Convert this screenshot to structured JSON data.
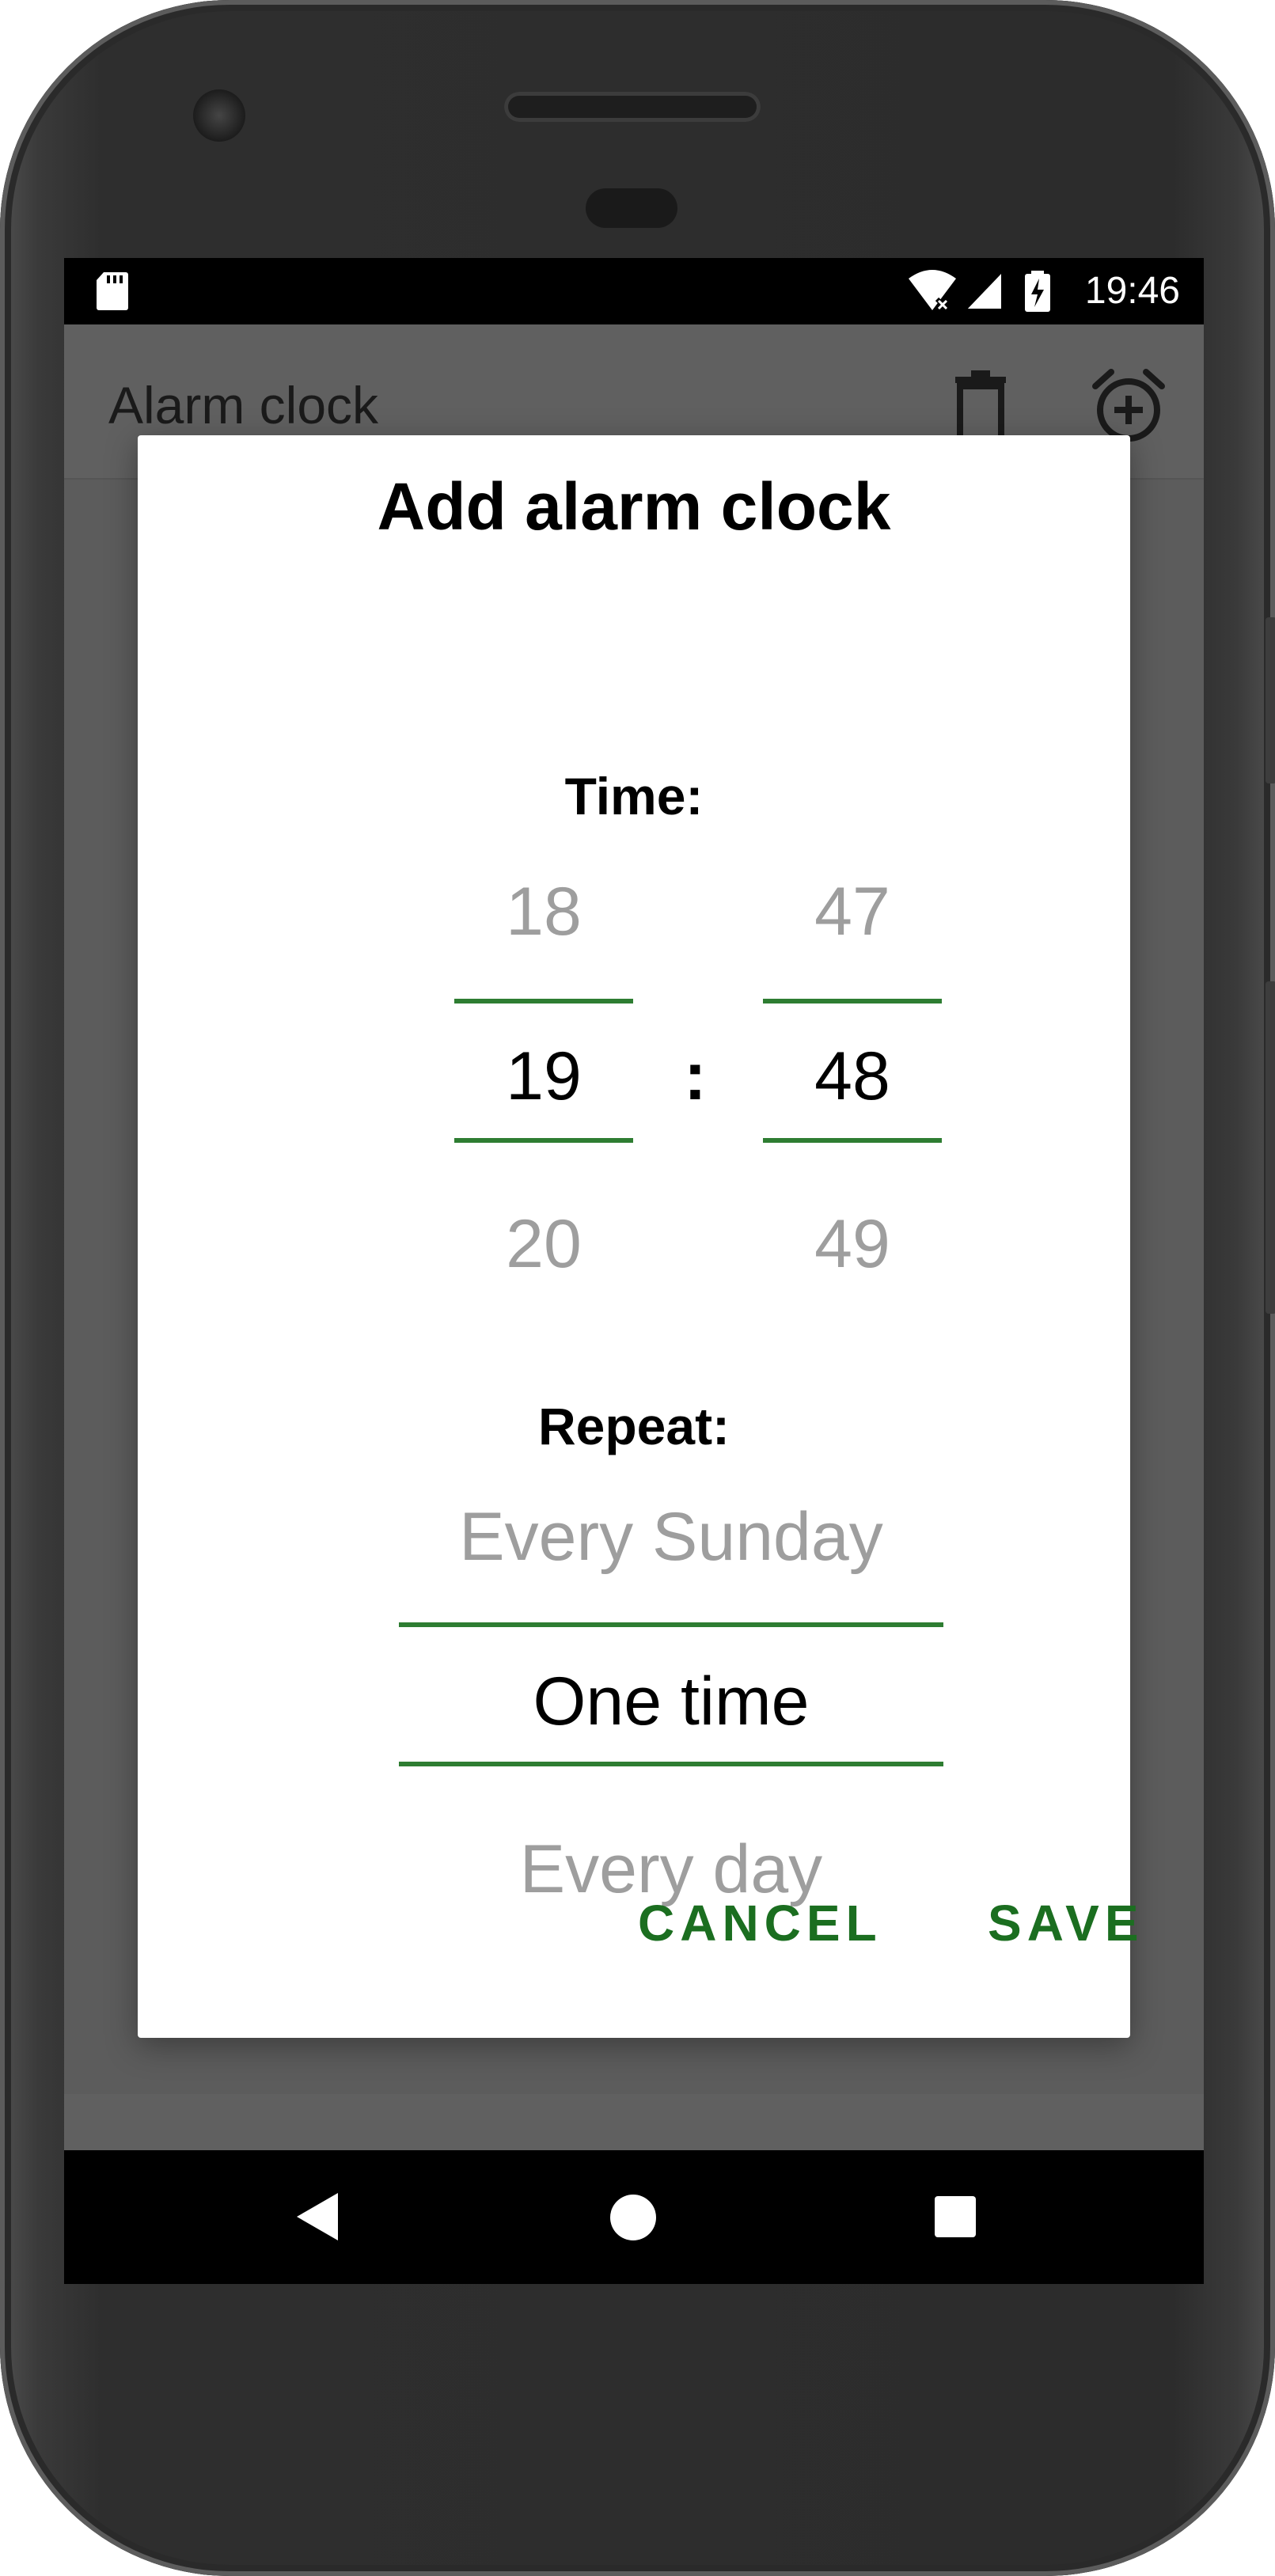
{
  "status_bar": {
    "time": "19:46",
    "icons": [
      "sd-card-icon",
      "wifi-icon",
      "signal-icon",
      "battery-charging-icon"
    ]
  },
  "app_bar": {
    "title": "Alarm clock",
    "actions": [
      "trash-icon",
      "alarm-add-icon"
    ]
  },
  "dialog": {
    "title": "Add alarm clock",
    "time_label": "Time:",
    "hours": {
      "prev": "18",
      "selected": "19",
      "next": "20"
    },
    "separator": ":",
    "minutes": {
      "prev": "47",
      "selected": "48",
      "next": "49"
    },
    "repeat_label": "Repeat:",
    "repeat": {
      "prev": "Every Sunday",
      "selected": "One time",
      "next": "Every day"
    },
    "cancel_label": "CANCEL",
    "save_label": "SAVE"
  },
  "nav_bar": {
    "buttons": [
      "back-icon",
      "home-icon",
      "recents-icon"
    ]
  },
  "colors": {
    "accent": "#2e7d32",
    "button_text": "#1b6e20",
    "scrim": "#606060",
    "dim_text": "#9e9e9e"
  }
}
